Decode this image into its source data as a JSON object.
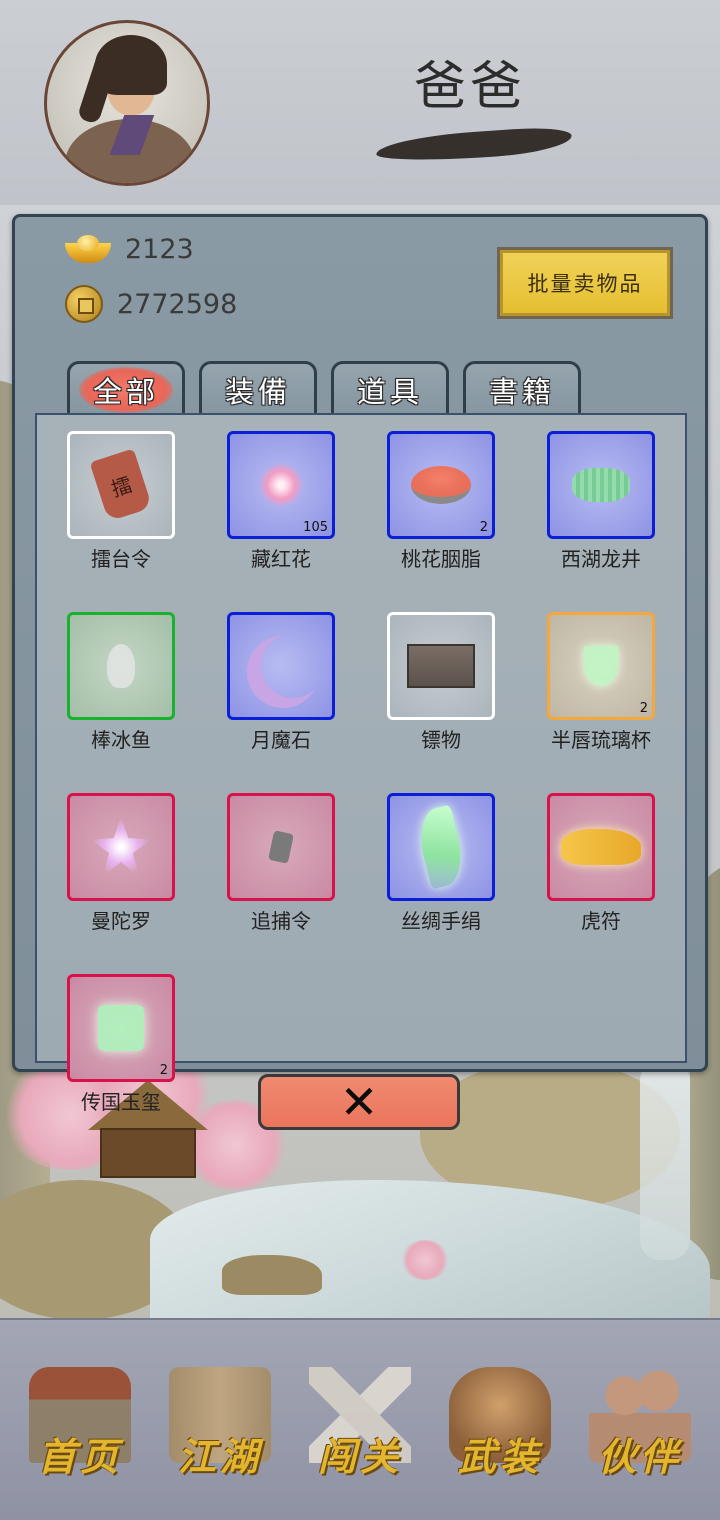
{
  "player": {
    "name": "爸爸"
  },
  "currency": {
    "gold": "2123",
    "coins": "2772598"
  },
  "sell_button": "批量卖物品",
  "tabs": [
    {
      "label": "全部",
      "active": true
    },
    {
      "label": "装備",
      "active": false
    },
    {
      "label": "道具",
      "active": false
    },
    {
      "label": "書籍",
      "active": false
    }
  ],
  "items": [
    {
      "name": "擂台令",
      "count": "",
      "rarity": "white",
      "icon": "token-icon",
      "glyph": "擂"
    },
    {
      "name": "藏红花",
      "count": "105",
      "rarity": "blue",
      "icon": "flower-icon",
      "glyph": ""
    },
    {
      "name": "桃花胭脂",
      "count": "2",
      "rarity": "blue",
      "icon": "rouge-disc-icon",
      "glyph": ""
    },
    {
      "name": "西湖龙井",
      "count": "",
      "rarity": "blue",
      "icon": "tea-icon",
      "glyph": ""
    },
    {
      "name": "棒冰鱼",
      "count": "",
      "rarity": "green",
      "icon": "fish-icon",
      "glyph": ""
    },
    {
      "name": "月魔石",
      "count": "",
      "rarity": "blue",
      "icon": "moon-stone-icon",
      "glyph": ""
    },
    {
      "name": "镖物",
      "count": "",
      "rarity": "white",
      "icon": "cargo-box-icon",
      "glyph": ""
    },
    {
      "name": "半唇琉璃杯",
      "count": "2",
      "rarity": "orange",
      "icon": "cup-icon",
      "glyph": ""
    },
    {
      "name": "曼陀罗",
      "count": "",
      "rarity": "red",
      "icon": "datura-flower-icon",
      "glyph": ""
    },
    {
      "name": "追捕令",
      "count": "",
      "rarity": "red",
      "icon": "warrant-tag-icon",
      "glyph": ""
    },
    {
      "name": "丝绸手绢",
      "count": "",
      "rarity": "blue",
      "icon": "silk-handkerchief-icon",
      "glyph": ""
    },
    {
      "name": "虎符",
      "count": "",
      "rarity": "red",
      "icon": "tiger-tally-icon",
      "glyph": ""
    },
    {
      "name": "传国玉玺",
      "count": "2",
      "rarity": "red",
      "icon": "jade-seal-icon",
      "glyph": ""
    }
  ],
  "close_button": {
    "icon": "close-icon",
    "glyph": "✕"
  },
  "bottom_nav": [
    {
      "label": "首页",
      "icon": "home-icon"
    },
    {
      "label": "江湖",
      "icon": "scroll-icon"
    },
    {
      "label": "闯关",
      "icon": "swords-icon"
    },
    {
      "label": "武装",
      "icon": "armor-icon"
    },
    {
      "label": "伙伴",
      "icon": "partner-icon"
    }
  ],
  "colors": {
    "rarity_white": "#ffffff",
    "rarity_blue": "#0b1fd8",
    "rarity_green": "#18b22e",
    "rarity_orange": "#f4a73c",
    "rarity_red": "#d8124a",
    "accent_tab": "#e96658",
    "sell_button": "#e5be2e"
  }
}
